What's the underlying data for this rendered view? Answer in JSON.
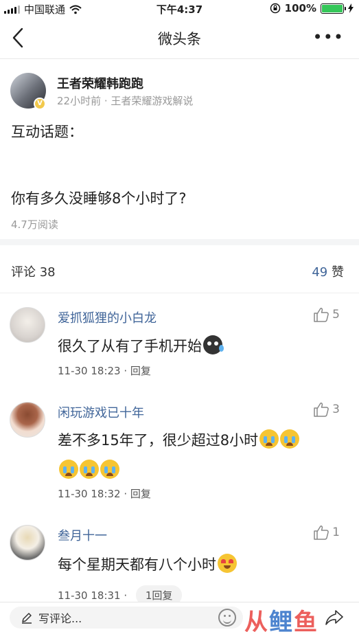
{
  "status_bar": {
    "carrier": "中国联通",
    "time": "下午4:37",
    "battery": "100%"
  },
  "nav": {
    "title": "微头条",
    "more": "•••"
  },
  "post": {
    "author": "王者荣耀韩跑跑",
    "meta": "22小时前 · 王者荣耀游戏解说",
    "line1": "互动话题：",
    "line2": "你有多久没睡够8个小时了?",
    "reads": "4.7万阅读"
  },
  "comments_header": {
    "label": "评论 38",
    "likes_count": "49",
    "likes_label": "赞"
  },
  "comments": [
    {
      "name": "爱抓狐狸的小白龙",
      "likes": "5",
      "text": "很久了从有了手机开始",
      "time": "11-30 18:23 · ",
      "reply": "回复"
    },
    {
      "name": "闲玩游戏已十年",
      "likes": "3",
      "text": "差不多15年了，很少超过8小时",
      "time": "11-30 18:32 · ",
      "reply": "回复"
    },
    {
      "name": "叁月十一",
      "likes": "1",
      "text": "每个星期天都有八个小时",
      "time": "11-30 18:31 · ",
      "reply": "1回复"
    }
  ],
  "bottom": {
    "comment_placeholder": "写评论...",
    "watermark_left": "从",
    "watermark_mid": "鲤",
    "watermark_right": "鱼"
  },
  "colors": {
    "link_blue": "#406599",
    "battery_green": "#35c759"
  },
  "icons": [
    "wifi-icon",
    "battery-icon",
    "back-arrow-icon",
    "more-icon",
    "verified-badge-icon",
    "thumbs-up-icon",
    "pen-icon",
    "smile-icon",
    "share-icon"
  ]
}
